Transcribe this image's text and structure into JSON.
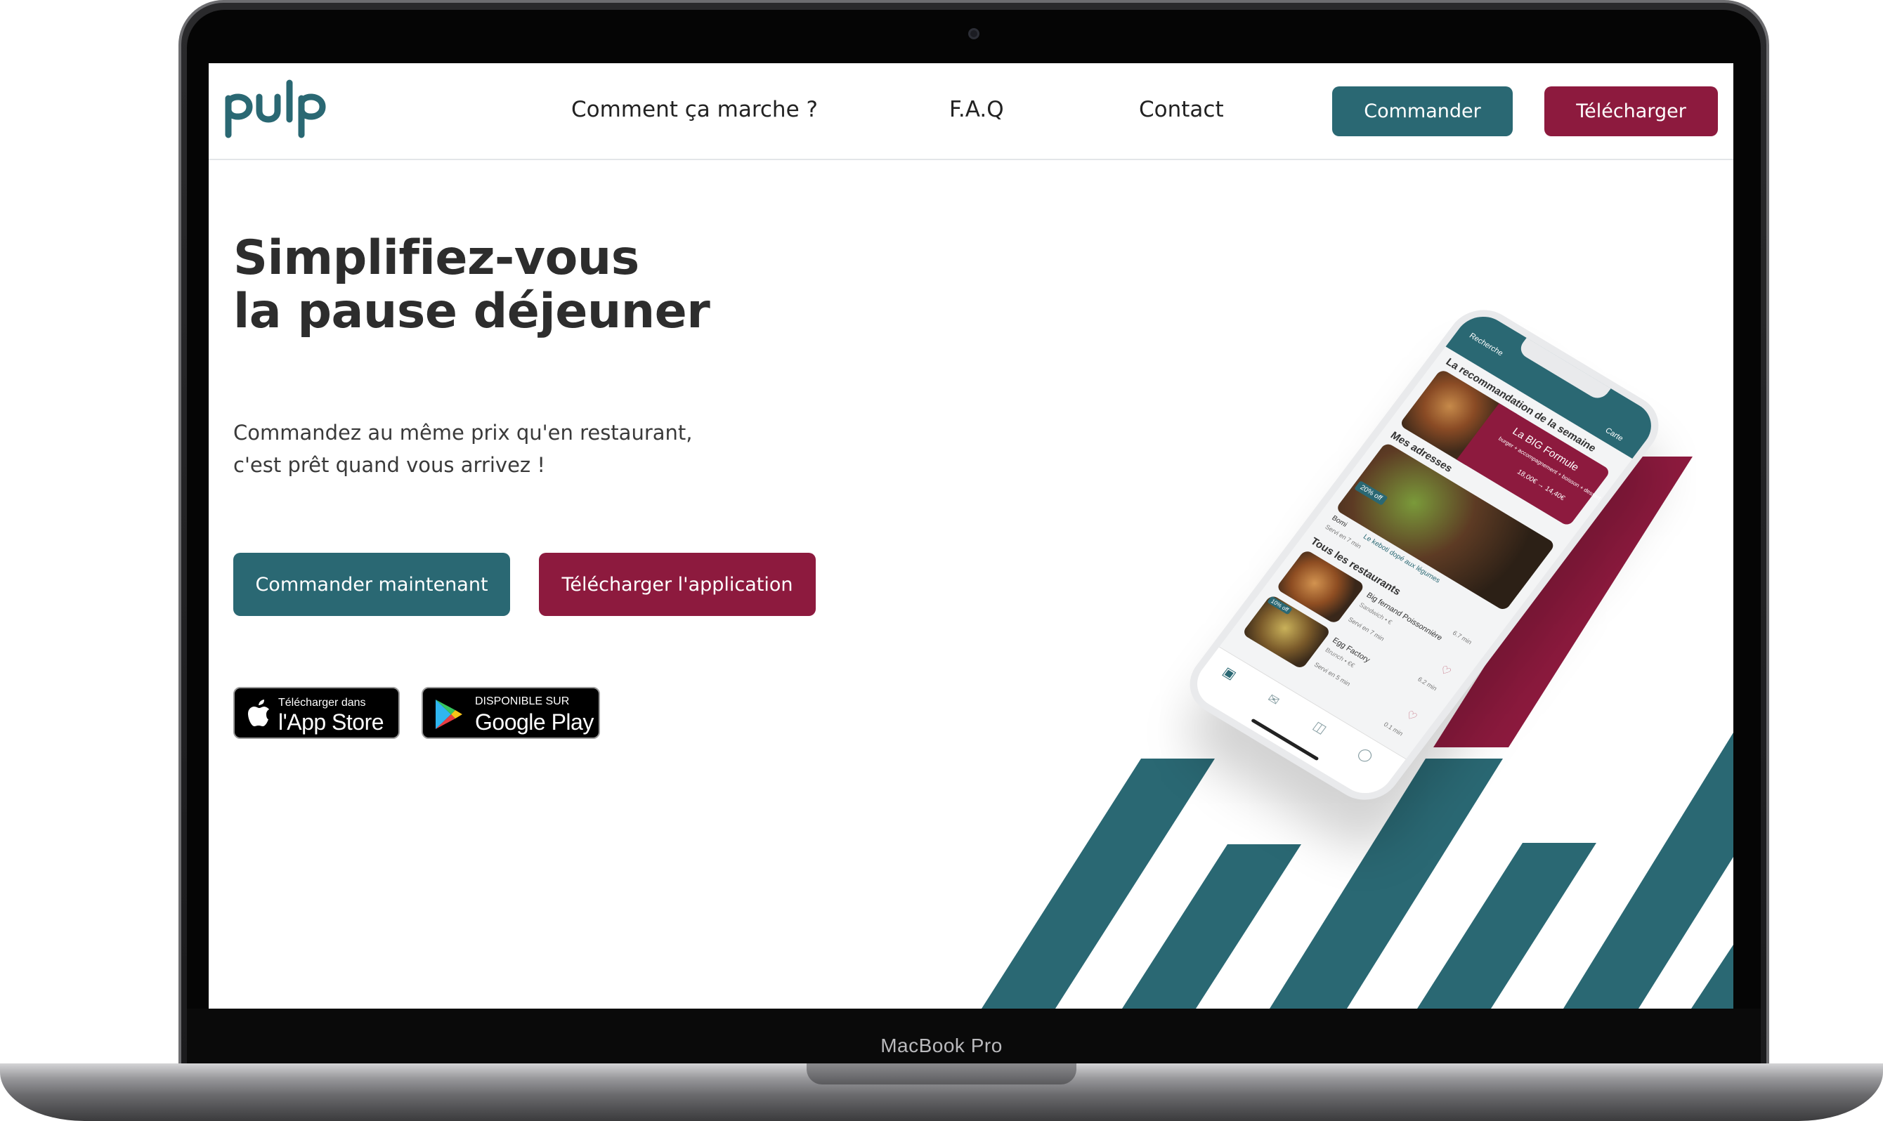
{
  "device": {
    "label": "MacBook Pro"
  },
  "header": {
    "nav": [
      {
        "label": "Comment ça marche ?"
      },
      {
        "label": "F.A.Q"
      },
      {
        "label": "Contact"
      }
    ],
    "order_button": "Commander",
    "download_button": "Télécharger"
  },
  "hero": {
    "title_line1": "Simplifiez-vous",
    "title_line2": "la pause déjeuner",
    "subtitle_line1": "Commandez au même prix qu'en restaurant,",
    "subtitle_line2": "c'est prêt quand vous arrivez !",
    "cta_primary": "Commander maintenant",
    "cta_secondary": "Télécharger l'application"
  },
  "stores": {
    "apple": {
      "small": "Télécharger dans",
      "big": "l'App Store",
      "icon": "apple-icon"
    },
    "google": {
      "small": "DISPONIBLE SUR",
      "big": "Google Play",
      "icon": "google-play-icon"
    }
  },
  "phone": {
    "search_label": "Recherche",
    "map_label": "Carte",
    "reco_title": "La recommandation de la semaine",
    "promo_title": "La BIG Formule",
    "promo_desc": "burger + accompagnement + boisson + dessert",
    "promo_price": "18,00€ → 14,40€",
    "addresses_title": "Mes adresses",
    "discount_badge": "20% off",
    "address_name": "Bomi",
    "address_dish": "Le keboti dopé aux légumes",
    "address_time": "Servi en 7 min",
    "all_title": "Tous les restaurants",
    "restaurants": [
      {
        "name": "Big fernand Poissonnière",
        "type": "Sandwich • €",
        "time": "Servi en 7 min",
        "distance": "6.7 min",
        "badge": ""
      },
      {
        "name": "Egg Factory",
        "type": "Brunch • €€",
        "time": "Servi en 5 min",
        "distance": "6.2 min",
        "badge": "10% off"
      }
    ],
    "last_distance": "0.1 min"
  },
  "colors": {
    "teal": "#2a6873",
    "wine": "#8d1a3e",
    "text": "#2d2d2d"
  }
}
